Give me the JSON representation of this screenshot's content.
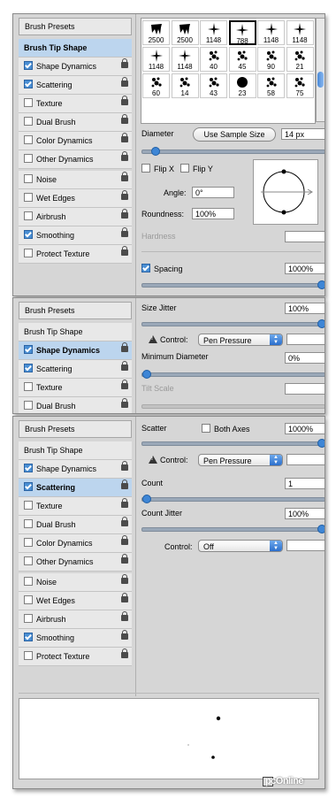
{
  "panels": [
    {
      "sidebar": {
        "header": "Brush Presets",
        "items": [
          {
            "label": "Brush Tip Shape",
            "checkbox": false,
            "checked": false,
            "lock": false,
            "selected": true
          },
          {
            "label": "Shape Dynamics",
            "checkbox": true,
            "checked": true,
            "lock": true,
            "selected": false
          },
          {
            "label": "Scattering",
            "checkbox": true,
            "checked": true,
            "lock": true,
            "selected": false
          },
          {
            "label": "Texture",
            "checkbox": true,
            "checked": false,
            "lock": true,
            "selected": false
          },
          {
            "label": "Dual Brush",
            "checkbox": true,
            "checked": false,
            "lock": true,
            "selected": false
          },
          {
            "label": "Color Dynamics",
            "checkbox": true,
            "checked": false,
            "lock": true,
            "selected": false
          },
          {
            "label": "Other Dynamics",
            "checkbox": true,
            "checked": false,
            "lock": true,
            "selected": false
          },
          {
            "label": "Noise",
            "checkbox": true,
            "checked": false,
            "lock": true,
            "selected": false
          },
          {
            "label": "Wet Edges",
            "checkbox": true,
            "checked": false,
            "lock": true,
            "selected": false
          },
          {
            "label": "Airbrush",
            "checkbox": true,
            "checked": false,
            "lock": true,
            "selected": false
          },
          {
            "label": "Smoothing",
            "checkbox": true,
            "checked": true,
            "lock": true,
            "selected": false
          },
          {
            "label": "Protect Texture",
            "checkbox": true,
            "checked": false,
            "lock": true,
            "selected": false
          }
        ]
      }
    }
  ],
  "tip_shape": {
    "tips": [
      {
        "num": "2500"
      },
      {
        "num": "2500"
      },
      {
        "num": "1148"
      },
      {
        "num": "788",
        "selected": true
      },
      {
        "num": "1148"
      },
      {
        "num": "1148"
      },
      {
        "num": "1148"
      },
      {
        "num": "1148"
      },
      {
        "num": "40"
      },
      {
        "num": "45"
      },
      {
        "num": "90"
      },
      {
        "num": "21"
      },
      {
        "num": "60"
      },
      {
        "num": "14"
      },
      {
        "num": "43"
      },
      {
        "num": "23"
      },
      {
        "num": "58"
      },
      {
        "num": "75"
      }
    ],
    "diameter_label": "Diameter",
    "use_sample_size": "Use Sample Size",
    "diameter_value": "14 px",
    "diameter_level": 0.05,
    "flip_x": "Flip X",
    "flip_y": "Flip Y",
    "angle_label": "Angle:",
    "angle_value": "0°",
    "roundness_label": "Roundness:",
    "roundness_value": "100%",
    "hardness_label": "Hardness",
    "spacing_label": "Spacing",
    "spacing_value": "1000%",
    "spacing_level": 1.0
  },
  "shape_dynamics": {
    "header": "Brush Presets",
    "items": [
      {
        "label": "Brush Tip Shape",
        "checkbox": false,
        "checked": false,
        "lock": false,
        "selected": false
      },
      {
        "label": "Shape Dynamics",
        "checkbox": true,
        "checked": true,
        "lock": true,
        "selected": true
      },
      {
        "label": "Scattering",
        "checkbox": true,
        "checked": true,
        "lock": true,
        "selected": false
      },
      {
        "label": "Texture",
        "checkbox": true,
        "checked": false,
        "lock": true,
        "selected": false
      },
      {
        "label": "Dual Brush",
        "checkbox": true,
        "checked": false,
        "lock": true,
        "selected": false
      }
    ],
    "size_jitter_label": "Size Jitter",
    "size_jitter_value": "100%",
    "size_jitter_level": 1.0,
    "control_label": "Control:",
    "control_value": "Pen Pressure",
    "min_diameter_label": "Minimum Diameter",
    "min_diameter_value": "0%",
    "min_diameter_level": 0.0,
    "tilt_scale_label": "Tilt Scale"
  },
  "scattering": {
    "header": "Brush Presets",
    "items": [
      {
        "label": "Brush Tip Shape",
        "checkbox": false,
        "checked": false,
        "lock": false,
        "selected": false
      },
      {
        "label": "Shape Dynamics",
        "checkbox": true,
        "checked": true,
        "lock": true,
        "selected": false
      },
      {
        "label": "Scattering",
        "checkbox": true,
        "checked": true,
        "lock": true,
        "selected": true
      },
      {
        "label": "Texture",
        "checkbox": true,
        "checked": false,
        "lock": true,
        "selected": false
      },
      {
        "label": "Dual Brush",
        "checkbox": true,
        "checked": false,
        "lock": true,
        "selected": false
      },
      {
        "label": "Color Dynamics",
        "checkbox": true,
        "checked": false,
        "lock": true,
        "selected": false
      },
      {
        "label": "Other Dynamics",
        "checkbox": true,
        "checked": false,
        "lock": true,
        "selected": false
      },
      {
        "label": "Noise",
        "checkbox": true,
        "checked": false,
        "lock": true,
        "selected": false
      },
      {
        "label": "Wet Edges",
        "checkbox": true,
        "checked": false,
        "lock": true,
        "selected": false
      },
      {
        "label": "Airbrush",
        "checkbox": true,
        "checked": false,
        "lock": true,
        "selected": false
      },
      {
        "label": "Smoothing",
        "checkbox": true,
        "checked": true,
        "lock": true,
        "selected": false
      },
      {
        "label": "Protect Texture",
        "checkbox": true,
        "checked": false,
        "lock": true,
        "selected": false
      }
    ],
    "scatter_label": "Scatter",
    "both_axes": "Both Axes",
    "scatter_value": "1000%",
    "scatter_level": 1.0,
    "control_label": "Control:",
    "control_value": "Pen Pressure",
    "count_label": "Count",
    "count_value": "1",
    "count_level": 0.0,
    "count_jitter_label": "Count Jitter",
    "count_jitter_value": "100%",
    "count_jitter_level": 1.0,
    "control2_label": "Control:",
    "control2_value": "Off"
  },
  "watermark": "pcOnline"
}
